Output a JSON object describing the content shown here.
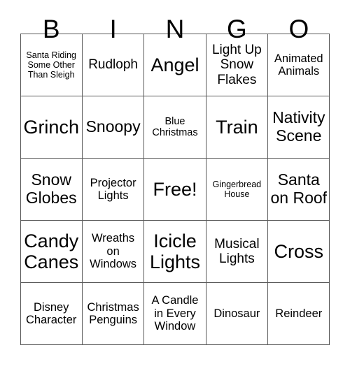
{
  "header": {
    "letters": [
      "B",
      "I",
      "N",
      "G",
      "O"
    ]
  },
  "grid": {
    "rows": [
      [
        {
          "label": "Santa Riding Some Other Than Sleigh",
          "size": "fs-xs"
        },
        {
          "label": "Rudloph",
          "size": "fs-lg"
        },
        {
          "label": "Angel",
          "size": "fs-xxl"
        },
        {
          "label": "Light Up Snow Flakes",
          "size": "fs-lg"
        },
        {
          "label": "Animated Animals",
          "size": "fs-md"
        }
      ],
      [
        {
          "label": "Grinch",
          "size": "fs-xxl"
        },
        {
          "label": "Snoopy",
          "size": "fs-xl"
        },
        {
          "label": "Blue Christmas",
          "size": "fs-sm"
        },
        {
          "label": "Train",
          "size": "fs-xxl"
        },
        {
          "label": "Nativity Scene",
          "size": "fs-xl"
        }
      ],
      [
        {
          "label": "Snow Globes",
          "size": "fs-xl"
        },
        {
          "label": "Projector Lights",
          "size": "fs-md"
        },
        {
          "label": "Free!",
          "size": "fs-xxl"
        },
        {
          "label": "Gingerbread House",
          "size": "fs-xs"
        },
        {
          "label": "Santa on Roof",
          "size": "fs-xl"
        }
      ],
      [
        {
          "label": "Candy Canes",
          "size": "fs-xxl"
        },
        {
          "label": "Wreaths on Windows",
          "size": "fs-md"
        },
        {
          "label": "Icicle Lights",
          "size": "fs-xxl"
        },
        {
          "label": "Musical Lights",
          "size": "fs-lg"
        },
        {
          "label": "Cross",
          "size": "fs-xxl"
        }
      ],
      [
        {
          "label": "Disney Character",
          "size": "fs-md"
        },
        {
          "label": "Christmas Penguins",
          "size": "fs-md"
        },
        {
          "label": "A Candle in Every Window",
          "size": "fs-md"
        },
        {
          "label": "Dinosaur",
          "size": "fs-md"
        },
        {
          "label": "Reindeer",
          "size": "fs-md"
        }
      ]
    ]
  },
  "colors": {
    "background": "#ffffff",
    "text": "#000000",
    "border": "#5a5a5a"
  }
}
